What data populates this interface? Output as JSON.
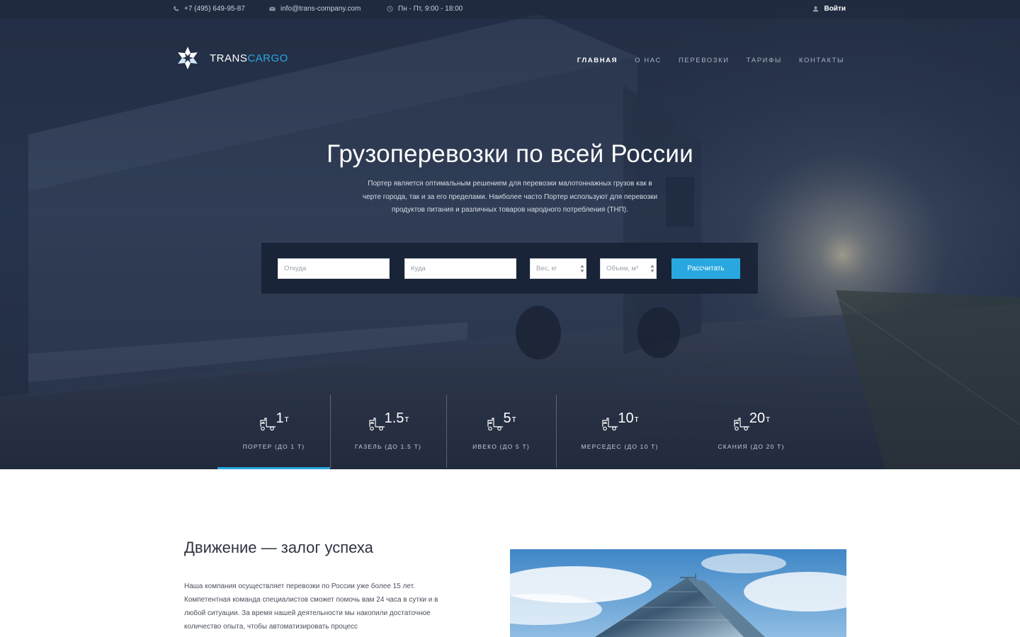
{
  "topbar": {
    "phone": "+7 (495) 649-95-87",
    "email": "info@trans-company.com",
    "hours": "Пн - Пт, 9:00 - 18:00",
    "login": "Войти"
  },
  "brand": {
    "name_part1": "TRANS",
    "name_part2": "CARGO",
    "accent_color": "#29a8e0"
  },
  "nav": {
    "items": [
      "ГЛАВНАЯ",
      "О НАС",
      "ПЕРЕВОЗКИ",
      "ТАРИФЫ",
      "КОНТАКТЫ"
    ],
    "active": "ГЛАВНАЯ"
  },
  "hero": {
    "title": "Грузоперевозки по всей России",
    "subtitle": "Портер является оптимальным решением для перевозки малотоннажных грузов как в черте города, так и за его пределами. Наиболее часто Портер используют для перевозки продуктов питания и различных товаров народного потребления (ТНП)."
  },
  "calculator": {
    "from_placeholder": "Откуда",
    "to_placeholder": "Куда",
    "weight_placeholder": "Вес, кг",
    "volume_placeholder": "Объем, м³",
    "submit_label": "Рассчитать"
  },
  "tonnage": {
    "items": [
      {
        "value": "1",
        "unit": "т",
        "label": "ПОРТЕР (ДО 1 Т)",
        "selected": true
      },
      {
        "value": "1.5",
        "unit": "т",
        "label": "ГАЗЕЛЬ (ДО 1.5 Т)",
        "selected": false
      },
      {
        "value": "5",
        "unit": "т",
        "label": "ИВЕКО (ДО 5 Т)",
        "selected": false
      },
      {
        "value": "10",
        "unit": "т",
        "label": "МЕРСЕДЕС (ДО 10 Т)",
        "selected": false
      },
      {
        "value": "20",
        "unit": "т",
        "label": "СКАНИЯ (ДО 20 Т)",
        "selected": false
      }
    ]
  },
  "about": {
    "title": "Движение — залог успеха",
    "text": "Наша компания осуществляет перевозки по России уже более 15 лет. Компетентная команда специалистов сможет помочь вам 24 часа в сутки и в любой ситуации. За время нашей деятельности мы накопили достаточное количество опыта, чтобы автоматизировать процесс"
  },
  "icons": {
    "phone": "phone-icon",
    "email": "mail-icon",
    "clock": "clock-icon",
    "user": "user-icon",
    "logo": "flower-logo-icon",
    "truck": "truck-icon"
  }
}
